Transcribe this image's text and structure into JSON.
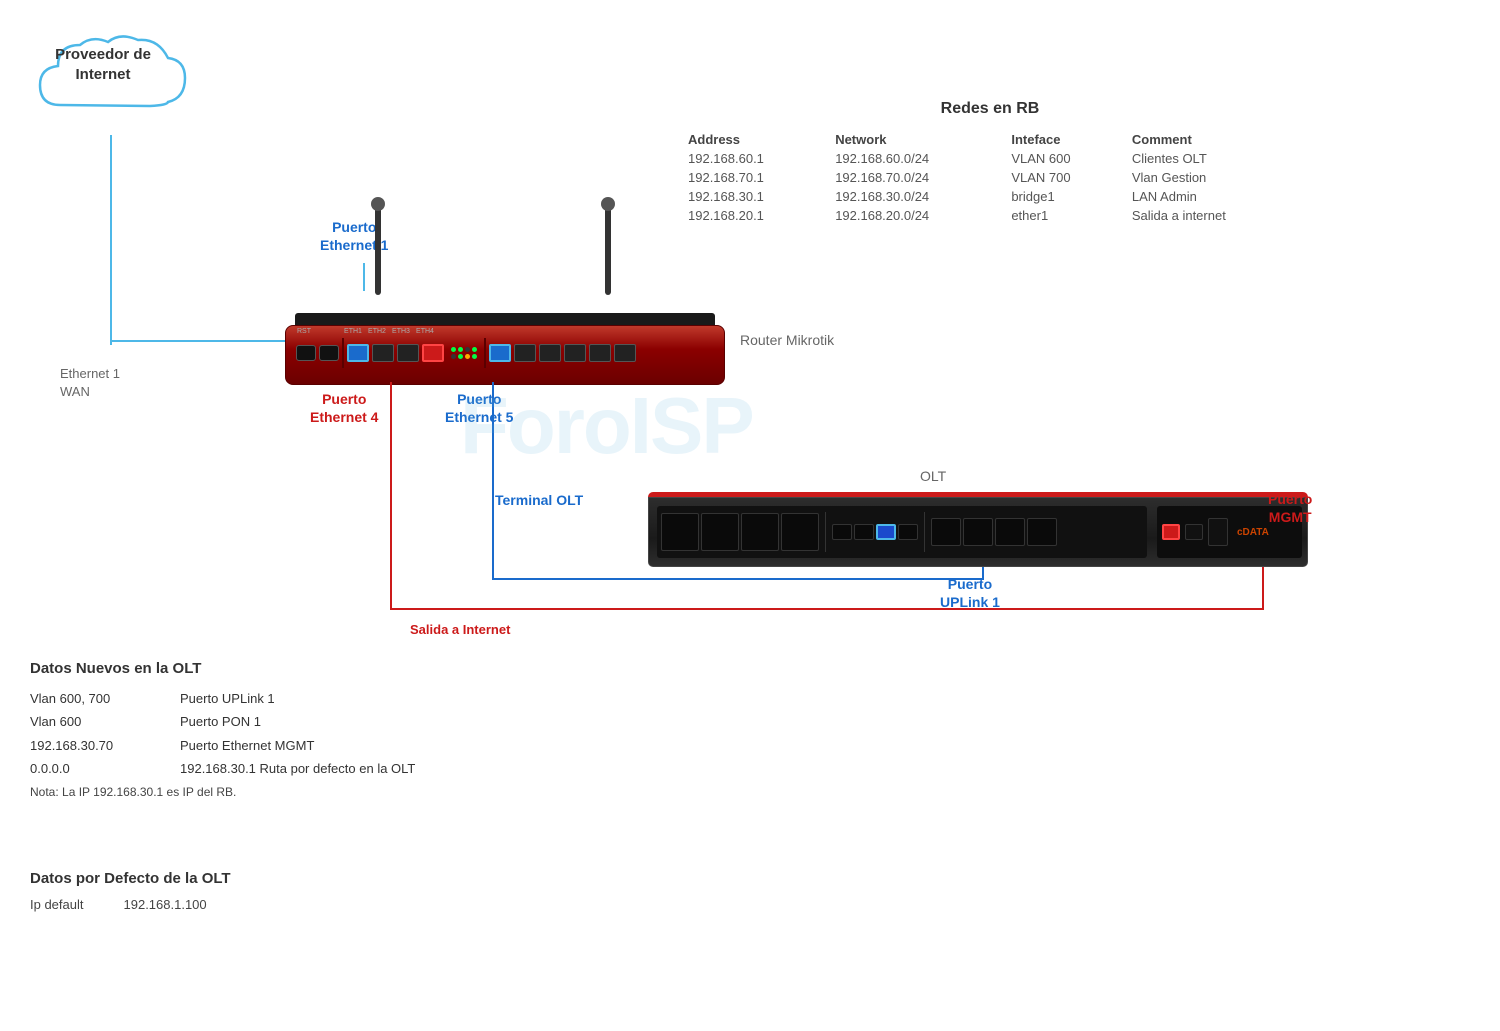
{
  "cloud": {
    "label_line1": "Proveedor de",
    "label_line2": "Internet"
  },
  "labels": {
    "eth1_wan": "Ethernet 1\nWAN",
    "eth1_wan_line1": "Ethernet 1",
    "eth1_wan_line2": "WAN",
    "router_mikrotik": "Router Mikrotik",
    "puerto_eth1_line1": "Puerto",
    "puerto_eth1_line2": "Ethernet 1",
    "puerto_eth4_line1": "Puerto",
    "puerto_eth4_line2": "Ethernet 4",
    "puerto_eth5_line1": "Puerto",
    "puerto_eth5_line2": "Ethernet 5",
    "terminal_olt": "Terminal OLT",
    "olt": "OLT",
    "salida_internet": "Salida a Internet",
    "puerto_uplink_line1": "Puerto",
    "puerto_uplink_line2": "UPLink 1",
    "puerto_mgmt_line1": "Puerto",
    "puerto_mgmt_line2": "MGMT",
    "watermark": "ForoISP"
  },
  "redes_rb": {
    "title": "Redes en RB",
    "headers": {
      "address": "Address",
      "network": "Network",
      "interface": "Inteface",
      "comment": "Comment"
    },
    "rows": [
      {
        "address": "192.168.60.1",
        "network": "192.168.60.0/24",
        "interface": "VLAN 600",
        "comment": "Clientes OLT"
      },
      {
        "address": "192.168.70.1",
        "network": "192.168.70.0/24",
        "interface": "VLAN 700",
        "comment": "Vlan Gestion"
      },
      {
        "address": "192.168.30.1",
        "network": "192.168.30.0/24",
        "interface": "bridge1",
        "comment": "LAN Admin"
      },
      {
        "address": "192.168.20.1",
        "network": "192.168.20.0/24",
        "interface": "ether1",
        "comment": "Salida a internet"
      }
    ]
  },
  "datos_nuevos": {
    "title": "Datos Nuevos en  la OLT",
    "rows": [
      {
        "col1": "Vlan 600, 700",
        "col2": "Puerto UPLink 1"
      },
      {
        "col1": "Vlan 600",
        "col2": "Puerto PON 1"
      },
      {
        "col1": "192.168.30.70",
        "col2": "Puerto Ethernet MGMT"
      },
      {
        "col1": "0.0.0.0",
        "col2": "192.168.30.1   Ruta  por defecto en la OLT"
      }
    ],
    "nota": "Nota: La IP 192.168.30.1 es IP del RB."
  },
  "datos_defecto": {
    "title": "Datos por Defecto de la OLT",
    "ip_label": "Ip default",
    "ip_value": "192.168.1.100"
  },
  "cdata_logo": "cDATA"
}
